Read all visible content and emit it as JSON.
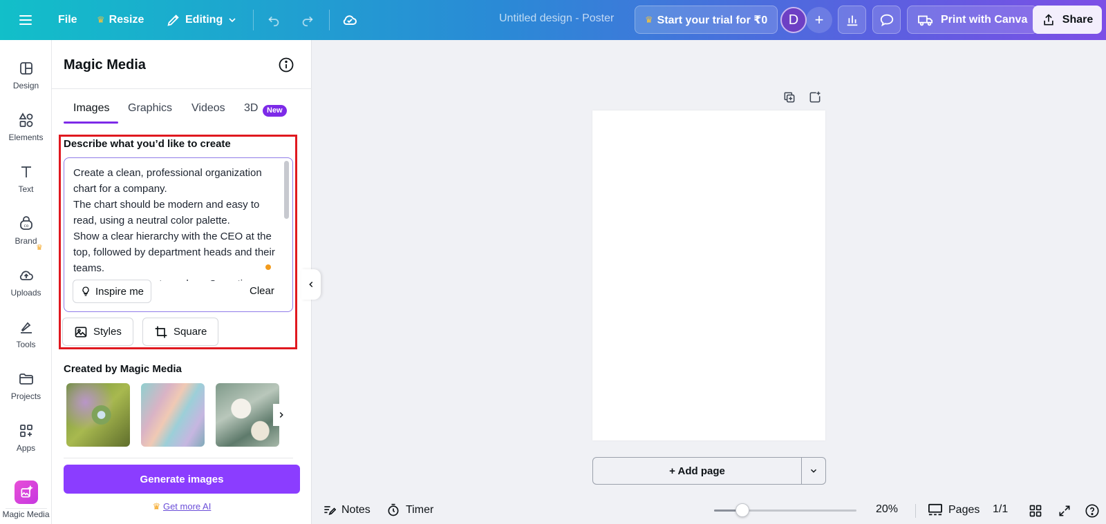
{
  "topbar": {
    "file_label": "File",
    "resize_label": "Resize",
    "editing_label": "Editing",
    "design_title": "Untitled design - Poster",
    "trial_label": "Start your trial for ₹0",
    "avatar_initial": "D",
    "print_label": "Print with Canva",
    "share_label": "Share"
  },
  "rail": {
    "items": [
      {
        "label": "Design",
        "icon": "layout-icon"
      },
      {
        "label": "Elements",
        "icon": "shapes-icon"
      },
      {
        "label": "Text",
        "icon": "text-icon"
      },
      {
        "label": "Brand",
        "icon": "brand-icon"
      },
      {
        "label": "Uploads",
        "icon": "cloud-upload-icon"
      },
      {
        "label": "Tools",
        "icon": "pen-tool-icon"
      },
      {
        "label": "Projects",
        "icon": "folder-icon"
      },
      {
        "label": "Apps",
        "icon": "apps-grid-icon"
      }
    ],
    "magic_label": "Magic Media"
  },
  "panel": {
    "title": "Magic Media",
    "tabs": [
      {
        "label": "Images"
      },
      {
        "label": "Graphics"
      },
      {
        "label": "Videos"
      },
      {
        "label": "3D"
      }
    ],
    "new_badge": "New",
    "describe_label": "Describe what you’d like to create",
    "prompt_text": "Create a clean, professional organization chart for a company.\nThe chart should be modern and easy to read, using a neutral color palette.\nShow a clear hierarchy with the CEO at the top, followed by department heads and their teams.\nInclude departments such as Operations,",
    "inspire_label": "Inspire me",
    "clear_label": "Clear",
    "styles_label": "Styles",
    "square_label": "Square",
    "created_label": "Created by Magic Media",
    "generate_label": "Generate images",
    "getmore_label": "Get more AI"
  },
  "canvas": {
    "addpage_label": "+ Add page"
  },
  "bottombar": {
    "notes_label": "Notes",
    "timer_label": "Timer",
    "zoom_label": "20%",
    "zoom_value": 0.2,
    "pages_label": "Pages",
    "pages_count": "1/1"
  },
  "colors": {
    "accent": "#8b3dff",
    "highlight_box": "#e0181f",
    "crown": "#f5a623"
  }
}
